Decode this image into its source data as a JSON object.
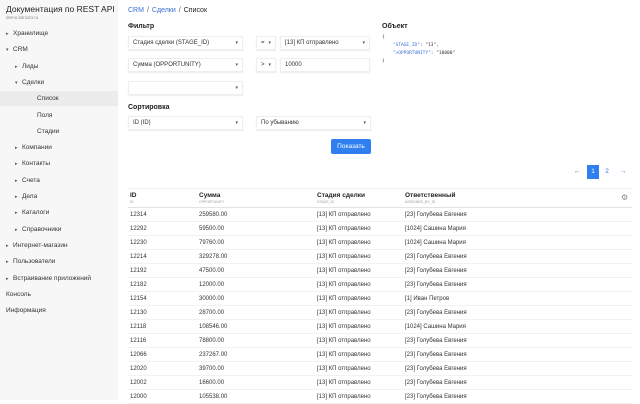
{
  "sidebar": {
    "title": "Документация по REST API",
    "subtitle": "demo.bitrix24.ru",
    "items": [
      {
        "label": "Хранилище",
        "level": 0,
        "arrow": "▸"
      },
      {
        "label": "CRM",
        "level": 0,
        "arrow": "▾"
      },
      {
        "label": "Лиды",
        "level": 1,
        "arrow": "▸"
      },
      {
        "label": "Сделки",
        "level": 1,
        "arrow": "▾"
      },
      {
        "label": "Список",
        "level": 2,
        "arrow": "",
        "selected": true
      },
      {
        "label": "Поля",
        "level": 2,
        "arrow": ""
      },
      {
        "label": "Стадии",
        "level": 2,
        "arrow": ""
      },
      {
        "label": "Компании",
        "level": 1,
        "arrow": "▸"
      },
      {
        "label": "Контакты",
        "level": 1,
        "arrow": "▸"
      },
      {
        "label": "Счета",
        "level": 1,
        "arrow": "▸"
      },
      {
        "label": "Дела",
        "level": 1,
        "arrow": "▸"
      },
      {
        "label": "Каталоги",
        "level": 1,
        "arrow": "▸"
      },
      {
        "label": "Справочники",
        "level": 1,
        "arrow": "▸"
      },
      {
        "label": "Интернет-магазин",
        "level": 0,
        "arrow": "▸"
      },
      {
        "label": "Пользователи",
        "level": 0,
        "arrow": "▸"
      },
      {
        "label": "Встраивание приложений",
        "level": 0,
        "arrow": "▸"
      },
      {
        "label": "Консоль",
        "level": 0,
        "arrow": ""
      },
      {
        "label": "Информация",
        "level": 0,
        "arrow": ""
      }
    ]
  },
  "breadcrumb": {
    "items": [
      "CRM",
      "Сделки"
    ],
    "current": "Список",
    "sep": "/"
  },
  "filter": {
    "title": "Фильтр",
    "rows": [
      {
        "field": "Стадия сделки (STAGE_ID)",
        "op": "=",
        "value": "[13] КП отправлено",
        "value_is_select": true
      },
      {
        "field": "Сумма (OPPORTUNITY)",
        "op": ">",
        "value": "10000",
        "value_is_select": false
      }
    ],
    "empty_field": ""
  },
  "sort": {
    "title": "Сортировка",
    "field": "ID (ID)",
    "order": "По убыванию"
  },
  "show_button": "Показать",
  "object": {
    "title": "Объект",
    "open": "{",
    "close": "}",
    "lines": [
      {
        "key": "\"STAGE_ID\"",
        "value": "\"13\","
      },
      {
        "key": "\">OPPORTUNITY\"",
        "value": "\"10000\""
      }
    ]
  },
  "pagination": {
    "prev": "←",
    "pages": [
      "1",
      "2"
    ],
    "current": "1",
    "next": "→"
  },
  "table": {
    "columns": [
      {
        "label": "ID",
        "code": "ID"
      },
      {
        "label": "Сумма",
        "code": "OPPORTUNITY"
      },
      {
        "label": "Стадия сделки",
        "code": "STAGE_ID"
      },
      {
        "label": "Ответственный",
        "code": "ASSIGNED_BY_ID"
      }
    ],
    "rows": [
      [
        "12314",
        "259580.00",
        "[13] КП отправлено",
        "[23] Голубева Евгения"
      ],
      [
        "12292",
        "59500.00",
        "[13] КП отправлено",
        "[1024] Сашина Мария"
      ],
      [
        "12230",
        "79760.00",
        "[13] КП отправлено",
        "[1024] Сашина Мария"
      ],
      [
        "12214",
        "329278.00",
        "[13] КП отправлено",
        "[23] Голубева Евгения"
      ],
      [
        "12192",
        "47500.00",
        "[13] КП отправлено",
        "[23] Голубева Евгения"
      ],
      [
        "12182",
        "12000.00",
        "[13] КП отправлено",
        "[23] Голубева Евгения"
      ],
      [
        "12154",
        "30000.00",
        "[13] КП отправлено",
        "[1] Иван Петров"
      ],
      [
        "12130",
        "28700.00",
        "[13] КП отправлено",
        "[23] Голубева Евгения"
      ],
      [
        "12118",
        "108546.00",
        "[13] КП отправлено",
        "[1024] Сашина Мария"
      ],
      [
        "12116",
        "78800.00",
        "[13] КП отправлено",
        "[23] Голубева Евгения"
      ],
      [
        "12066",
        "237267.00",
        "[13] КП отправлено",
        "[23] Голубева Евгения"
      ],
      [
        "12020",
        "39700.00",
        "[13] КП отправлено",
        "[23] Голубева Евгения"
      ],
      [
        "12002",
        "16600.00",
        "[13] КП отправлено",
        "[23] Голубева Евгения"
      ],
      [
        "12000",
        "105538.00",
        "[13] КП отправлено",
        "[23] Голубева Евгения"
      ]
    ]
  },
  "colors": {
    "accent": "#2f7ff0",
    "link": "#3b6fd6"
  }
}
